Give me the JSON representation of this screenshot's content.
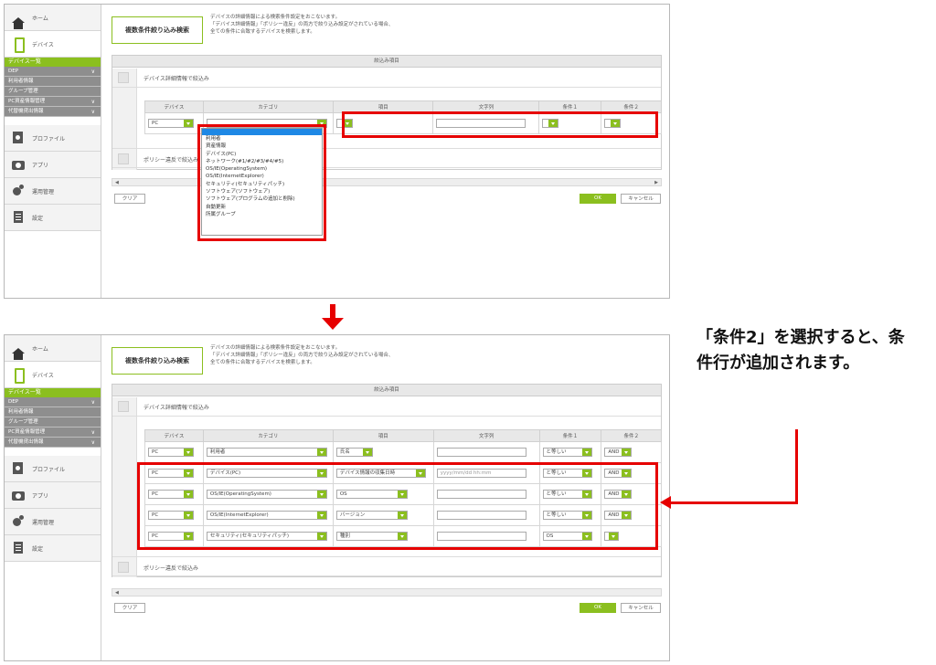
{
  "sidebar": {
    "home": "ホーム",
    "device": "デバイス",
    "sub_active": "デバイス一覧",
    "subs": [
      "DEP",
      "利用者情報",
      "グループ管理",
      "PC資産情報管理",
      "代替機貸出情報"
    ],
    "profile": "プロファイル",
    "app": "アプリ",
    "ops": "運用管理",
    "settings": "設定"
  },
  "main": {
    "title": "複数条件絞り込み検索",
    "desc_1": "デバイスの詳細情報による検索条件設定をおこないます。",
    "desc_2": "「デバイス詳細情報」「ポリシー違反」の両方で絞り込み設定がされている場合、",
    "desc_3": "全ての条件に合致するデバイスを検索します。",
    "panel_head": "絞込み項目",
    "detail_check": "デバイス詳細情報で絞込み",
    "policy_check": "ポリシー違反で絞込み",
    "policy_check_short": "ポリシー違反で絞込み",
    "clear": "クリア",
    "ok": "OK",
    "cancel": "キャンセル",
    "left_arrow": "◀",
    "right_arrow": "▶"
  },
  "table_headers": [
    "デバイス",
    "カテゴリ",
    "項目",
    "文字列",
    "条件１",
    "条件２"
  ],
  "top_row": {
    "device": "PC"
  },
  "dropdown_options": [
    "利用者",
    "資産情報",
    "デバイス(PC)",
    "ネットワーク(#1/#2/#3/#4/#5)",
    "OS/IE(OperatingSystem)",
    "OS/IE(InternetExplorer)",
    "セキュリティ(セキュリティパッチ)",
    "ソフトウェア(ソフトウェア)",
    "ソフトウェア(プログラムの追加と削除)",
    "自動更新",
    "所属グループ"
  ],
  "bottom_rows": [
    {
      "device": "PC",
      "category": "利用者",
      "item": "氏名",
      "text": "",
      "cond1": "と等しい",
      "cond2": "AND"
    },
    {
      "device": "PC",
      "category": "デバイス(PC)",
      "item": "デバイス情報の収集日時",
      "text": "yyyy/mm/dd hh:mm",
      "cond1": "と等しい",
      "cond2": "AND"
    },
    {
      "device": "PC",
      "category": "OS/IE(OperatingSystem)",
      "item": "OS",
      "text": "",
      "cond1": "と等しい",
      "cond2": "AND"
    },
    {
      "device": "PC",
      "category": "OS/IE(InternetExplorer)",
      "item": "バージョン",
      "text": "",
      "cond1": "と等しい",
      "cond2": "AND"
    },
    {
      "device": "PC",
      "category": "セキュリティ(セキュリティパッチ)",
      "item": "種別",
      "text": "",
      "cond1": "OS",
      "cond2": ""
    }
  ],
  "annotation": "「条件2」を選択すると、条件行が追加されます。",
  "colors": {
    "accent": "#8bbf1f",
    "highlight": "#e60000",
    "selection": "#1e88e5"
  }
}
